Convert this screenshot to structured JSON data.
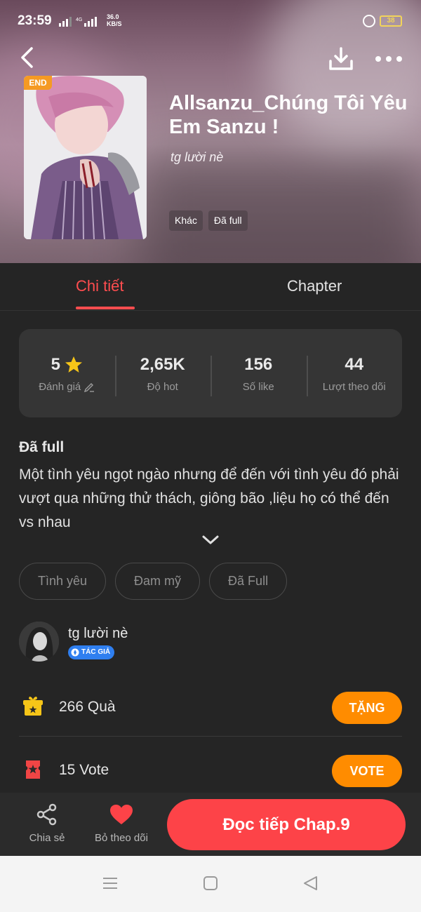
{
  "status_bar": {
    "time": "23:59",
    "network_line1": "36.0",
    "network_line2": "KB/S",
    "battery": "38"
  },
  "book": {
    "badge": "END",
    "title": "Allsanzu_Chúng Tôi Yêu Em Sanzu !",
    "author": "tg lười nè",
    "tags": [
      "Khác",
      "Đã full"
    ]
  },
  "tabs": {
    "detail": "Chi tiết",
    "chapter": "Chapter"
  },
  "stats": [
    {
      "value": "5",
      "label": "Đánh giá",
      "icon": "star-icon"
    },
    {
      "value": "2,65K",
      "label": "Độ hot"
    },
    {
      "value": "156",
      "label": "Số like"
    },
    {
      "value": "44",
      "label": "Lượt theo dõi"
    }
  ],
  "description": {
    "status": "Đã full",
    "text": "Một tình yêu ngọt ngào nhưng để đến với tình yêu đó phải vượt qua những thử thách, giông bão ,liệu họ có thể đến vs nhau"
  },
  "genres": [
    "Tình yêu",
    "Đam mỹ",
    "Đã Full"
  ],
  "author_section": {
    "name": "tg lười nè",
    "badge": "TÁC GIẢ"
  },
  "gift": {
    "text": "266  Quà",
    "button": "TẶNG"
  },
  "vote": {
    "text": "15  Vote",
    "button": "VOTE"
  },
  "bottom_bar": {
    "share": "Chia sẻ",
    "unfollow": "Bỏ theo dõi",
    "read": "Đọc tiếp Chap.9"
  },
  "colors": {
    "accent": "#ff4d4f",
    "read_button": "#fd4348",
    "action_button": "#ff8c00",
    "badge_end": "#f59a23",
    "background": "#252525"
  }
}
